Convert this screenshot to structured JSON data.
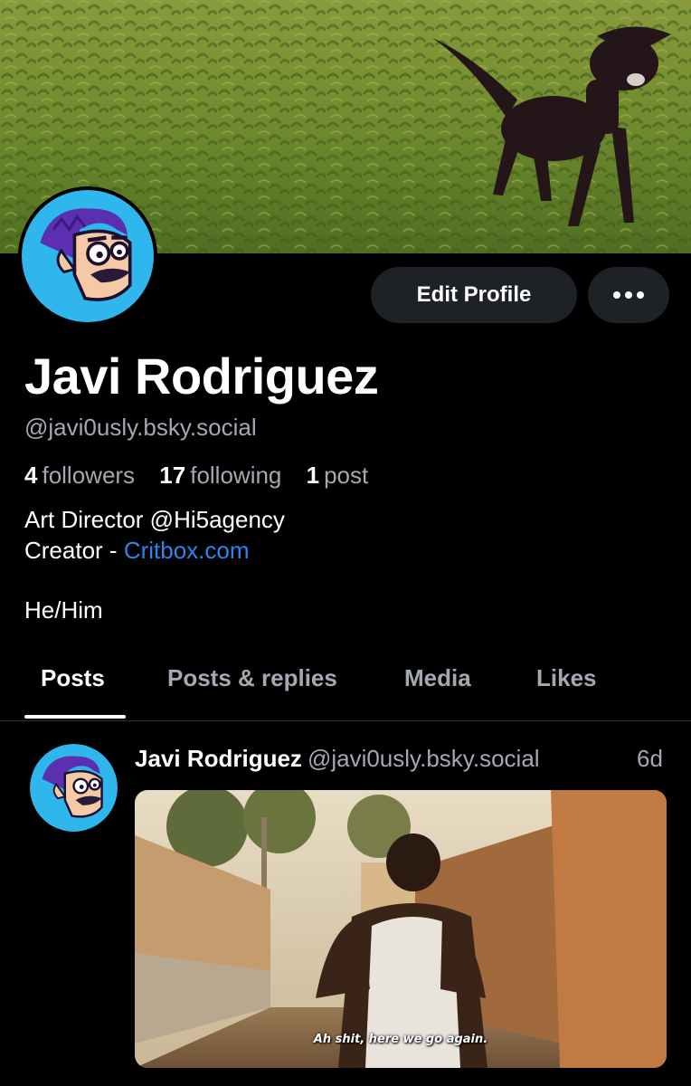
{
  "profile": {
    "display_name": "Javi Rodriguez",
    "handle": "@javi0usly.bsky.social",
    "followers_count": "4",
    "followers_label": "followers",
    "following_count": "17",
    "following_label": "following",
    "posts_count": "1",
    "posts_label": "post",
    "bio_line1": "Art Director @Hi5agency",
    "bio_line2_prefix": "Creator - ",
    "bio_link": "Critbox.com",
    "pronouns": "He/Him"
  },
  "actions": {
    "edit_profile": "Edit Profile",
    "more_icon": "ellipsis-icon"
  },
  "tabs": [
    {
      "label": "Posts",
      "active": true
    },
    {
      "label": "Posts & replies",
      "active": false
    },
    {
      "label": "Media",
      "active": false
    },
    {
      "label": "Likes",
      "active": false
    }
  ],
  "post": {
    "author_name": "Javi Rodriguez",
    "author_handle": "@javi0usly.bsky.social",
    "time": "6d",
    "media_caption": "Ah shit, here we go again."
  },
  "colors": {
    "background": "#000000",
    "muted_text": "#a3a8b2",
    "link": "#2b86ee",
    "button_bg": "#1e2126",
    "avatar_bg": "#2fb6ec"
  }
}
